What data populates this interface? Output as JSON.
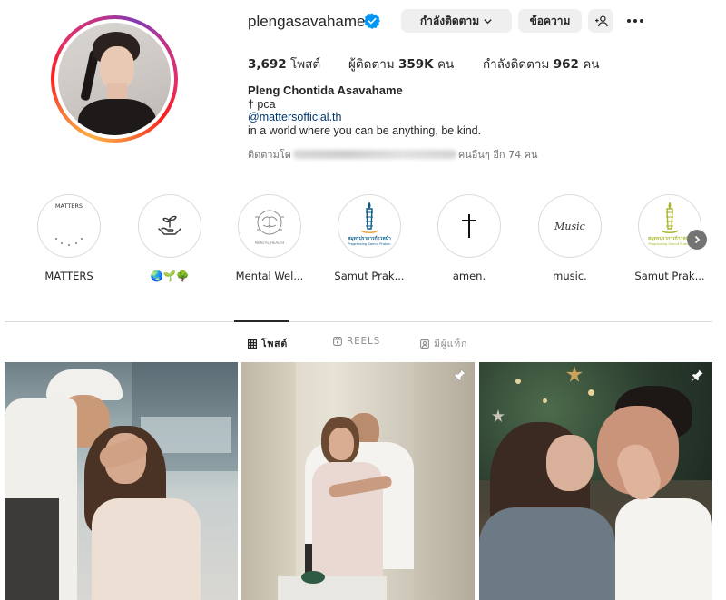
{
  "header": {
    "username": "plengasavahame",
    "buttons": {
      "following": "กำลังติดตาม",
      "message": "ข้อความ"
    },
    "stats": {
      "posts_count": "3,692",
      "posts_label": "โพสต์",
      "followers_label": "ผู้ติดตาม",
      "followers_count": "359K",
      "followers_unit": "คน",
      "following_label": "กำลังติดตาม",
      "following_count": "962",
      "following_unit": "คน"
    },
    "bio": {
      "full_name": "Pleng Chontida Asavahame",
      "line1": "† pca",
      "link": "@mattersofficial.th",
      "line3": "in a world where you can be anything, be kind."
    },
    "followed_by": {
      "prefix": "ติดตามโด",
      "suffix": "คนอื่นๆ อีก 74 คน"
    }
  },
  "highlights": [
    {
      "label": "MATTERS",
      "icon": "matters-logo"
    },
    {
      "label": "🌏🌱🌳",
      "icon": "hands-plant-icon"
    },
    {
      "label": "Mental Wel...",
      "icon": "brain-icon"
    },
    {
      "label": "Samut Prak...",
      "icon": "samut-prakan-logo"
    },
    {
      "label": "amen.",
      "icon": "cross-icon"
    },
    {
      "label": "music.",
      "icon": "music-script"
    },
    {
      "label": "Samut Prak...",
      "icon": "samut-prakan-logo"
    }
  ],
  "highlight_texts": {
    "matters_logo": "MATTERS",
    "music_script": "Music",
    "mental_health": "MENTAL HEALTH",
    "samut_title": "สมุทรปราการก้าวหน้า",
    "samut_sub": "Progressing Samut Prakan"
  },
  "tabs": [
    {
      "label": "โพสต์",
      "active": true,
      "icon": "grid-icon"
    },
    {
      "label": "REELS",
      "active": false,
      "icon": "reels-icon"
    },
    {
      "label": "มีผู้แท็ก",
      "active": false,
      "icon": "tagged-icon"
    }
  ],
  "posts": [
    {
      "pinned": false
    },
    {
      "pinned": true
    },
    {
      "pinned": true
    }
  ],
  "colors": {
    "verified": "#0095f6",
    "link": "#00376b",
    "button_bg": "#efefef",
    "divider": "#dbdbdb",
    "muted_text": "#737373"
  }
}
